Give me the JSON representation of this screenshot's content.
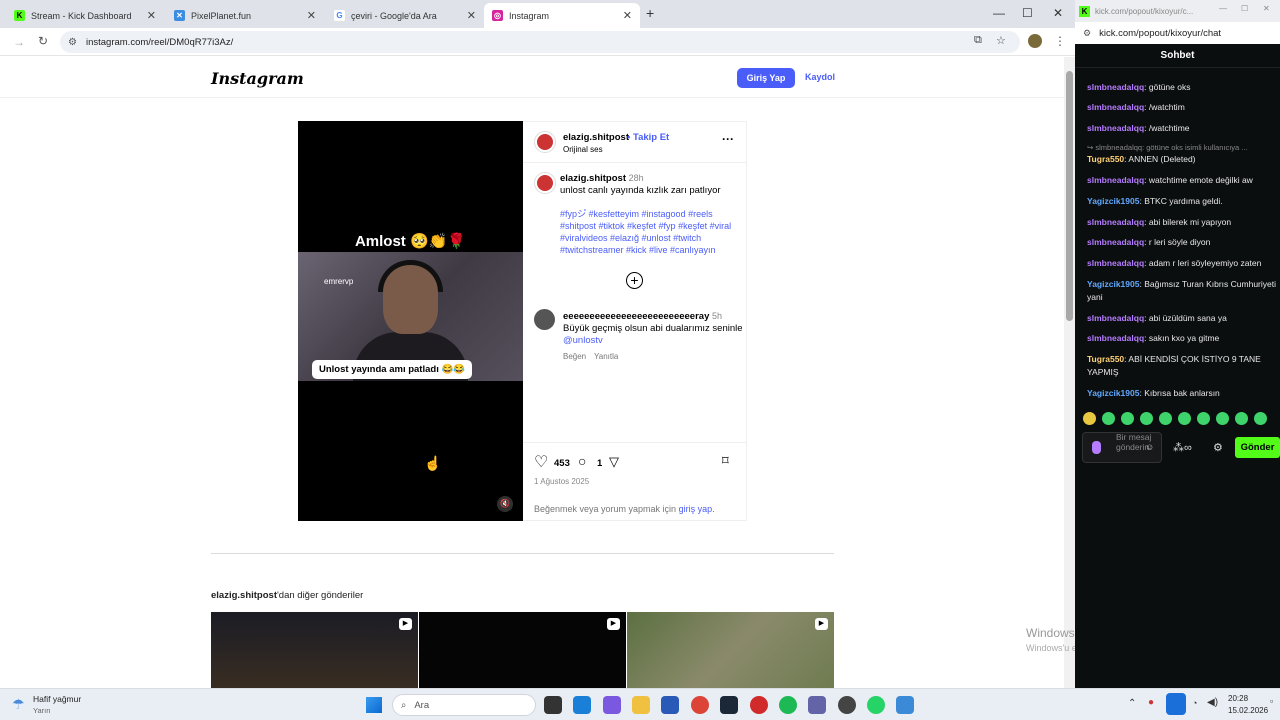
{
  "browser": {
    "tabs": [
      {
        "title": "Stream - Kick Dashboard",
        "favicon": "kick-icon",
        "color": "#53fc18"
      },
      {
        "title": "PixelPlanet.fun",
        "favicon": "pixelplanet-icon",
        "color": "#e43"
      },
      {
        "title": "çeviri - Google'da Ara",
        "favicon": "google-icon",
        "color": "#4285f4"
      },
      {
        "title": "Instagram",
        "favicon": "instagram-icon",
        "color": "#d6249f"
      }
    ],
    "new_tab": "+",
    "url": "instagram.com/reel/DM0qR77i3Az/"
  },
  "instagram": {
    "logo": "Instagram",
    "login": "Giriş Yap",
    "signup": "Kaydol",
    "video": {
      "top_text": "Amlost 🥺👏🌹",
      "caption": "Unlost yayında amı patladı 😂😂",
      "streamer_tag": "emrervp"
    },
    "post": {
      "username": "elazig.shitpost",
      "follow": "Takip Et",
      "audio": "Orijinal ses",
      "more": "···",
      "caption_user": "elazig.shitpost",
      "caption_time": "28h",
      "caption_text": "unlost canlı yayında kızlık zarı patlıyor",
      "hashtags": "#fypシ゚ #kesfetteyim #instagood #reels #shitpost #tiktok #keşfet #fyp #keşfet #viral #viralvideos #elazığ #unlost #twitch #twitchstreamer #kick #live #canlıyayın",
      "comment_user": "eeeeeeeeeeeeeeeeeeeeeeeeeray",
      "comment_time": "5h",
      "comment_text": "Büyük geçmiş olsun abi dualarımız seninle ",
      "comment_mention": "@unlostv",
      "comment_like": "Beğen",
      "comment_reply": "Yanıtla",
      "likes": "453",
      "comments": "1",
      "date": "1 Ağustos 2025",
      "login_prompt": "Beğenmek veya yorum yapmak için ",
      "login_prompt_link": "giriş yap."
    },
    "more_from_user": "elazig.shitpost",
    "more_from_suffix": "'dan diğer gönderiler"
  },
  "watermark": {
    "title": "Windows'u Etkinleştir",
    "subtitle": "Windows'u etkinleştirmek için Ayarlar'a gidin."
  },
  "chat": {
    "window_title": "kick.com/popout/kixoyur/c...",
    "url": "kick.com/popout/kixoyur/chat",
    "header": "Sohbet",
    "messages": [
      {
        "user": "slmbneadalqq",
        "text": ": götüne oks",
        "color": "purple"
      },
      {
        "user": "slmbneadalqq",
        "text": ": /watchtim",
        "color": "purple"
      },
      {
        "user": "slmbneadalqq",
        "text": ": /watchtime",
        "color": "purple"
      },
      {
        "user": "Tugra550",
        "text": ": ANNEN (Deleted)",
        "color": "yellow"
      },
      {
        "user": "slmbneadalqq",
        "text": ": watchtime emote değilki aw",
        "color": "purple"
      },
      {
        "user": "Yagizcik1905",
        "text": ": BTKC yardıma geldi.",
        "color": "blue"
      },
      {
        "user": "slmbneadalqq",
        "text": ": abi bilerek mi yapıyon",
        "color": "purple"
      },
      {
        "user": "slmbneadalqq",
        "text": ": r leri söyle diyon",
        "color": "purple"
      },
      {
        "user": "slmbneadalqq",
        "text": ": adam r leri söyleyemiyo zaten",
        "color": "purple"
      },
      {
        "user": "Yagizcik1905",
        "text": ": Bağımsız Turan Kıbrıs Cumhuriyeti yani",
        "color": "blue"
      },
      {
        "user": "slmbneadalqq",
        "text": ": abi üzüldüm sana ya",
        "color": "purple"
      },
      {
        "user": "slmbneadalqq",
        "text": ": sakın kxo ya gitme",
        "color": "purple"
      },
      {
        "user": "Tugra550",
        "text": ": ABİ KENDİSİ ÇOK İSTİYO 9 TANE YAPMIŞ",
        "color": "yellow"
      },
      {
        "user": "Yagizcik1905",
        "text": ": Kıbrısa bak anlarsın",
        "color": "blue"
      }
    ],
    "reply_hint": "slmbneadalqq: götüne oks isimli kullanıcıya ...",
    "input_placeholder": "Bir mesaj gönderin",
    "send": "Gönder"
  },
  "taskbar": {
    "weather": "Hafif yağmur",
    "weather_sub": "Yarın",
    "search": "Ara",
    "time": "20:28",
    "date": "15.02.2026"
  }
}
